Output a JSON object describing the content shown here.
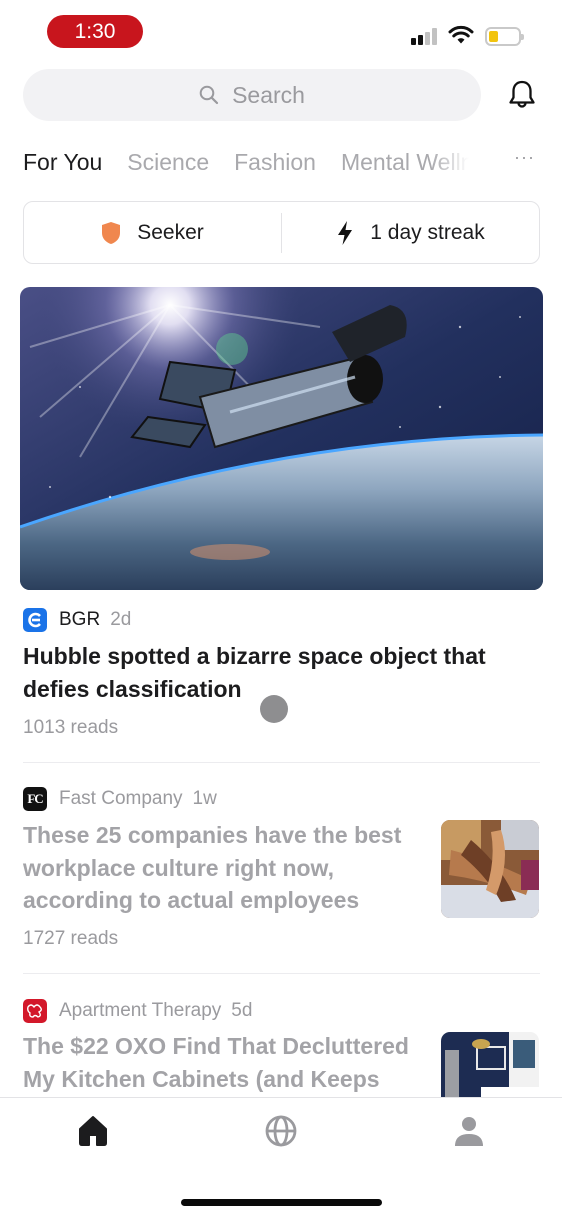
{
  "status_bar": {
    "time": "1:30",
    "signal_icon": "cellular-signal-icon",
    "wifi_icon": "wifi-icon",
    "battery_icon": "battery-low-icon",
    "battery_level_fraction": 0.25,
    "time_pill_color": "#c8151d",
    "battery_color": "#f2c40f"
  },
  "header": {
    "search": {
      "placeholder": "Search",
      "icon": "search-icon"
    },
    "notifications_icon": "bell-icon"
  },
  "tabs": [
    {
      "label": "For You",
      "active": true
    },
    {
      "label": "Science",
      "active": false
    },
    {
      "label": "Fashion",
      "active": false
    },
    {
      "label": "Mental Wellness",
      "active": false
    }
  ],
  "tabs_more_label": "···",
  "stats": {
    "rank": {
      "icon": "shield-icon",
      "label": "Seeker",
      "icon_color": "#f0874e"
    },
    "streak": {
      "icon": "lightning-bolt-icon",
      "label": "1 day streak"
    }
  },
  "feed": [
    {
      "source": "BGR",
      "age": "2d",
      "logo_color": "#1a73e8",
      "headline_lines": [
        "Hubble spotted a bizarre space object that",
        "defies classification"
      ],
      "reads": "1013 reads",
      "image": "hubble-telescope-over-earth",
      "read": false
    },
    {
      "source": "Fast Company",
      "age": "1w",
      "logo_text": "FC",
      "logo_color": "#111111",
      "headline_lines": [
        "These 25 companies have the best",
        "workplace culture right now,",
        "according to actual employees"
      ],
      "reads": "1727 reads",
      "image": "stacked-hands-teamwork",
      "read": true
    },
    {
      "source": "Apartment Therapy",
      "age": "5d",
      "logo_color": "#d3182a",
      "headline_lines": [
        "The $22 OXO Find That Decluttered",
        "My Kitchen Cabinets (and Keeps"
      ],
      "image": "kitchen-interior",
      "read": true
    }
  ],
  "bottom_nav": [
    {
      "name": "home",
      "icon": "home-icon",
      "active": true
    },
    {
      "name": "explore",
      "icon": "globe-icon",
      "active": false
    },
    {
      "name": "profile",
      "icon": "person-icon",
      "active": false
    }
  ]
}
